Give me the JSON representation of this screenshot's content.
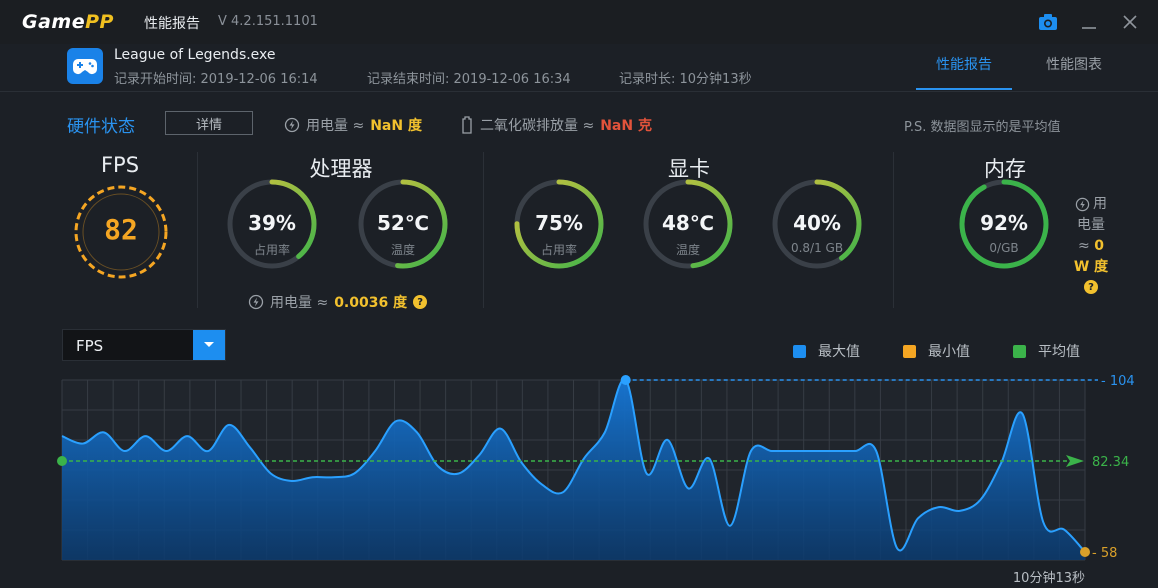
{
  "titlebar": {
    "logo_main": "Game",
    "logo_accent": "PP",
    "app_name": "性能报告",
    "version": "V 4.2.151.1101",
    "camera_icon": "camera-icon",
    "minimize_icon": "minimize-icon",
    "close_icon": "close-icon"
  },
  "header": {
    "game_name": "League of Legends.exe",
    "game_icon": "gamepad-icon",
    "start_time": "记录开始时间: 2019-12-06 16:14",
    "end_time": "记录结束时间: 2019-12-06 16:34",
    "duration": "记录时长: 10分钟13秒",
    "tabs": [
      {
        "label": "性能报告",
        "active": true
      },
      {
        "label": "性能图表",
        "active": false
      }
    ]
  },
  "status": {
    "section_label": "硬件状态",
    "detail_button": "详情",
    "power_label": "用电量 ≈",
    "power_value": "NaN 度",
    "co2_label": "二氧化碳排放量 ≈",
    "co2_value": "NaN 克",
    "ps_note": "P.S. 数据图显示的是平均值"
  },
  "groups": {
    "fps": {
      "title": "FPS",
      "value": "82"
    },
    "cpu": {
      "title": "处理器",
      "usage": {
        "value": "39%",
        "label": "占用率",
        "percent": 39
      },
      "temp": {
        "value": "52℃",
        "label": "温度",
        "percent": 52
      },
      "power_label": "用电量 ≈",
      "power_value": "0.0036 度"
    },
    "gpu": {
      "title": "显卡",
      "usage": {
        "value": "75%",
        "label": "占用率",
        "percent": 75
      },
      "temp": {
        "value": "48℃",
        "label": "温度",
        "percent": 48
      },
      "vram": {
        "value": "40%",
        "label": "0.8/1 GB",
        "percent": 40
      }
    },
    "memory": {
      "title": "内存",
      "usage": {
        "value": "92%",
        "label": "0/GB",
        "percent": 92
      },
      "power_line1": "用",
      "power_line2": "电量",
      "power_line3": "≈",
      "power_value": "0",
      "power_unit": "W 度"
    }
  },
  "chart_controls": {
    "metric_select": "FPS",
    "legend": [
      {
        "name": "最大值",
        "color": "#1d8ef0"
      },
      {
        "name": "最小值",
        "color": "#f5a623"
      },
      {
        "name": "平均值",
        "color": "#3bb34a"
      }
    ]
  },
  "colors": {
    "accent_blue": "#1d8ef0",
    "avg_green": "#3bb34a",
    "min_orange": "#f5a623",
    "gauge_yellow": "#c9c24a",
    "gauge_track": "#3a4048"
  },
  "chart_data": {
    "type": "area",
    "series": [
      {
        "name": "FPS",
        "values": [
          89,
          87,
          90,
          85,
          89,
          85,
          89,
          85,
          92,
          86,
          79,
          77,
          78,
          78,
          79,
          85,
          93,
          90,
          81,
          79,
          84,
          91,
          82,
          76,
          74,
          83,
          90,
          104,
          79,
          88,
          75,
          83,
          65,
          85,
          85,
          85,
          85,
          85,
          85,
          85,
          59,
          67,
          70,
          69,
          72,
          82,
          95,
          66,
          64,
          58
        ]
      },
      {
        "name": "平均值",
        "values": [
          82.34
        ]
      }
    ],
    "max": 104,
    "avg": 82.34,
    "min": 58,
    "ylim": [
      58,
      104
    ],
    "x_end_label": "10分钟13秒",
    "grid": true
  }
}
